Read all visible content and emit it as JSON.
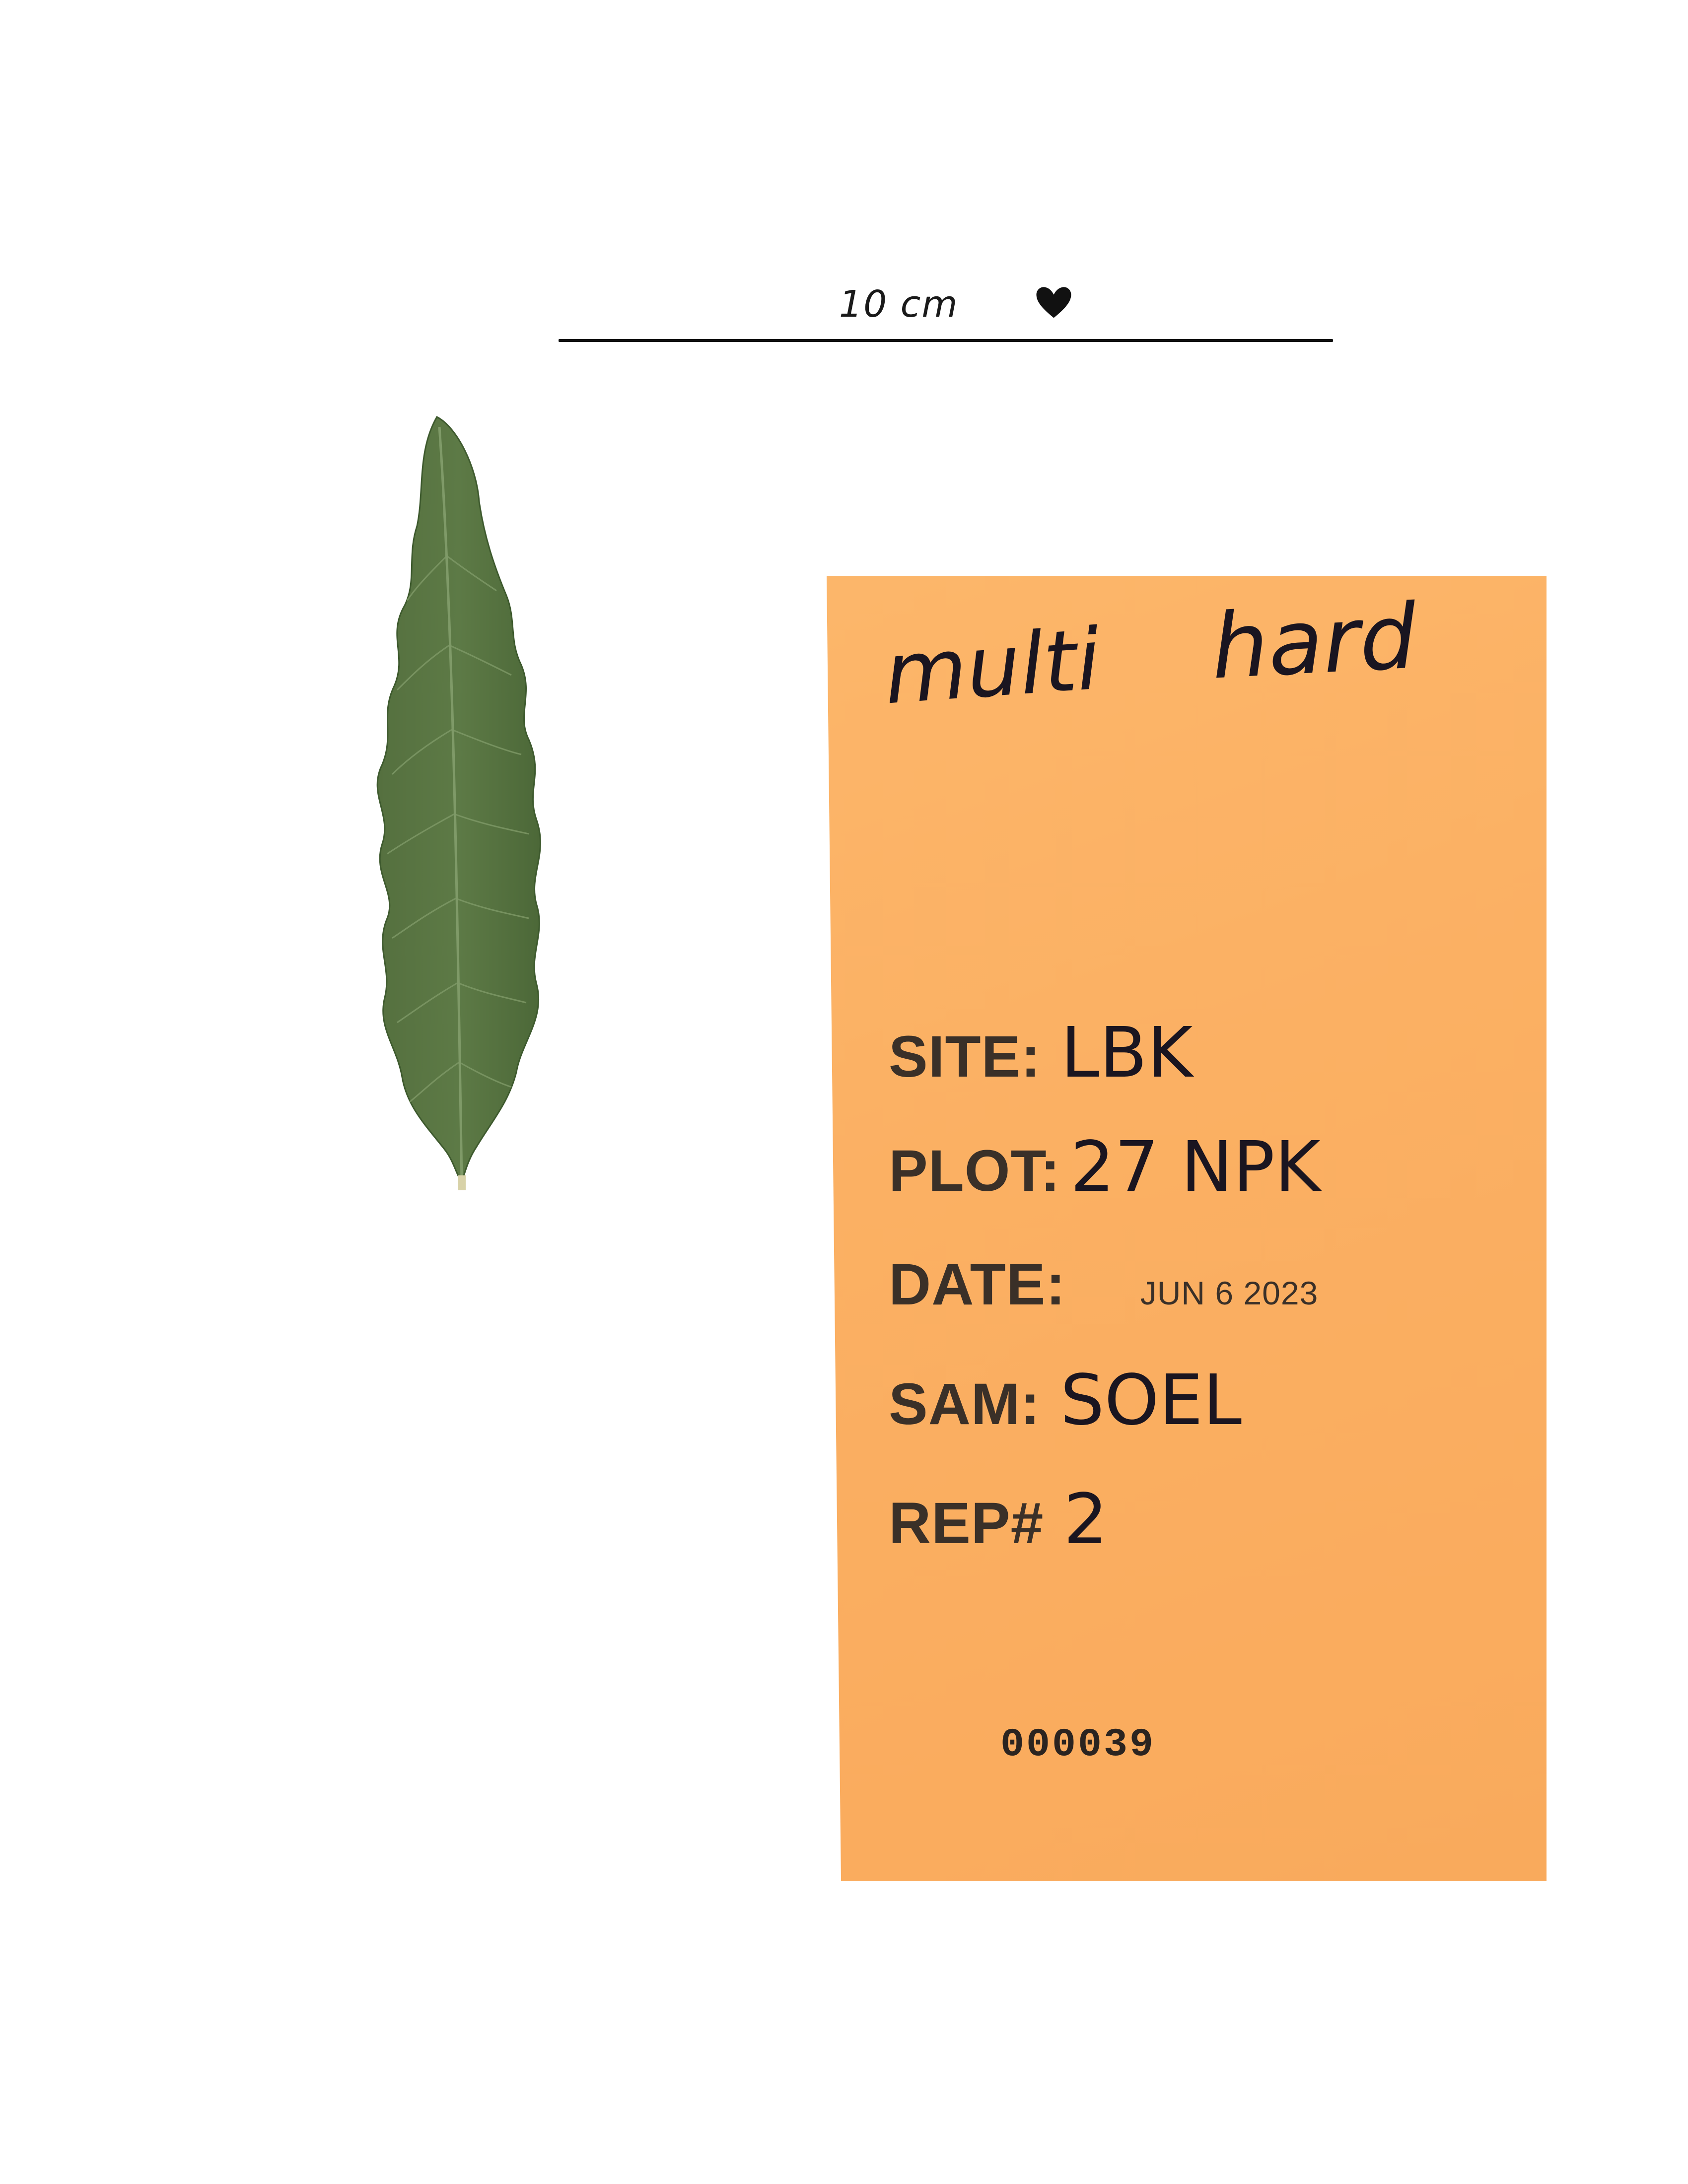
{
  "scale": {
    "label": "10 cm"
  },
  "envelope": {
    "handwritten_top_left": "multi",
    "handwritten_top_right": "hard",
    "fields": {
      "site_label": "SITE:",
      "site_value": "LBK",
      "plot_label": "PLOT:",
      "plot_value": "27 NPK",
      "date_label": "DATE:",
      "date_value": "JUN  6 2023",
      "sam_label": "SAM:",
      "sam_value": "SOEL",
      "rep_label": "REP#",
      "rep_value": "2"
    },
    "serial_number": "000039"
  },
  "colors": {
    "envelope": "#fbb063",
    "leaf": "#4e6b3a",
    "ink": "#1a1520"
  },
  "icons": {
    "heart": "heart-icon"
  }
}
